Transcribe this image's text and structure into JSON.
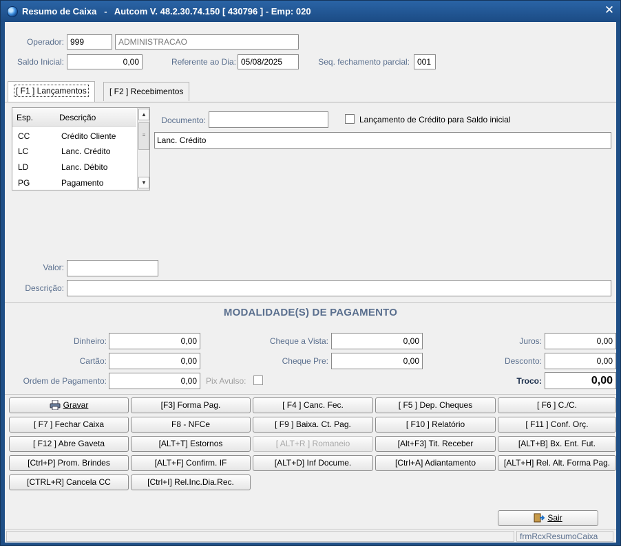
{
  "window": {
    "title": "Resumo de Caixa   -   Autcom V. 48.2.30.74.150 [ 430796 ] - Emp: 020",
    "close_glyph": "✕"
  },
  "header": {
    "operador_label": "Operador:",
    "operador_code": "999",
    "operador_name": "ADMINISTRACAO",
    "saldo_inicial_label": "Saldo Inicial:",
    "saldo_inicial_value": "0,00",
    "referente_label": "Referente ao Dia:",
    "referente_value": "05/08/2025",
    "seq_label": "Seq. fechamento parcial:",
    "seq_value": "001"
  },
  "tabs": [
    {
      "label": "[ F1 ] Lançamentos",
      "active": true
    },
    {
      "label": "[ F2 ] Recebimentos",
      "active": false
    }
  ],
  "lancamentos": {
    "grid": {
      "columns": [
        "Esp.",
        "Descrição"
      ],
      "rows": [
        [
          "CC",
          "Crédito Cliente"
        ],
        [
          "LC",
          "Lanc. Crédito"
        ],
        [
          "LD",
          "Lanc. Débito"
        ],
        [
          "PG",
          "Pagamento"
        ]
      ],
      "selected_row": 0
    },
    "documento_label": "Documento:",
    "documento_value": "",
    "credito_checkbox_label": "Lançamento de Crédito para Saldo inicial",
    "credito_checkbox_checked": false,
    "tipo_display": "Lanc. Crédito",
    "valor_label": "Valor:",
    "valor_value": "",
    "descricao_label": "Descrição:",
    "descricao_value": ""
  },
  "modalidades": {
    "title": "MODALIDADE(S)  DE PAGAMENTO",
    "dinheiro_label": "Dinheiro:",
    "dinheiro_value": "0,00",
    "cartao_label": "Cartão:",
    "cartao_value": "0,00",
    "ordem_label": "Ordem de Pagamento:",
    "ordem_value": "0,00",
    "pix_label": "Pix Avulso:",
    "pix_checked": false,
    "cheque_vista_label": "Cheque a Vista:",
    "cheque_vista_value": "0,00",
    "cheque_pre_label": "Cheque Pre:",
    "cheque_pre_value": "0,00",
    "juros_label": "Juros:",
    "juros_value": "0,00",
    "desconto_label": "Desconto:",
    "desconto_value": "0,00",
    "troco_label": "Troco:",
    "troco_value": "0,00"
  },
  "buttons": {
    "gravar": "Gravar",
    "forma_pag": "[F3] Forma Pag.",
    "canc_fec": "[ F4 ] Canc. Fec.",
    "dep_cheques": "[ F5 ] Dep. Cheques",
    "cc": "[ F6 ] C./C.",
    "fechar_caixa": "[ F7 ] Fechar Caixa",
    "nfce": "F8 - NFCe",
    "baixa_ct_pag": "[ F9 ] Baixa. Ct. Pag.",
    "relatorio": "[ F10 ] Relatório",
    "conf_orc": "[ F11 ] Conf. Orç.",
    "abre_gaveta": "[ F12 ] Abre Gaveta",
    "estornos": "[ALT+T] Estornos",
    "romaneio": "[ ALT+R ] Romaneio",
    "tit_receber": "[Alt+F3] Tit. Receber",
    "bx_ent_fut": "[ALT+B] Bx. Ent. Fut.",
    "prom_brindes": "[Ctrl+P] Prom. Brindes",
    "confirm_if": "[ALT+F] Confirm. IF",
    "inf_docume": "[ALT+D] Inf Docume.",
    "adiantamento": "[Ctrl+A] Adiantamento",
    "rel_alt_forma_pag": "[ALT+H] Rel. Alt. Forma Pag.",
    "cancela_cc": "[CTRL+R] Cancela CC",
    "rel_inc_dia_rec": "[Ctrl+I] Rel.Inc.Dia.Rec.",
    "sair": "Sair"
  },
  "statusbar": {
    "form_name": "frmRcxResumoCaixa"
  },
  "colors": {
    "title_bar": "#1f4f86",
    "label": "#5a6f8e",
    "background": "#f0f0f0"
  }
}
